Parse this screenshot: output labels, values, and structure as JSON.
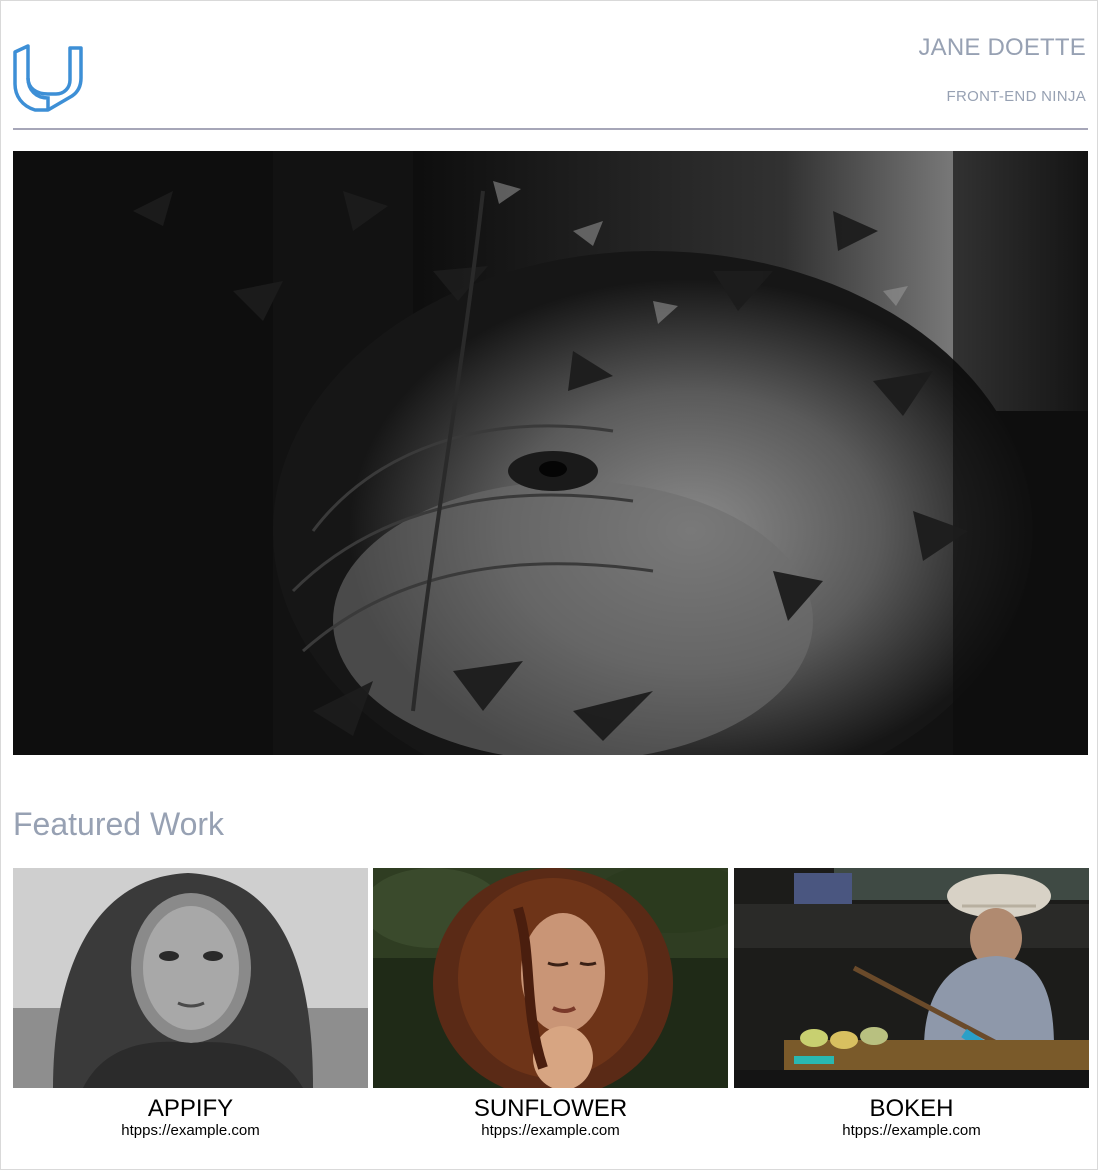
{
  "header": {
    "logo_icon": "udacity-u-logo-icon",
    "name": "JANE DOETTE",
    "role": "FRONT-END NINJA",
    "accent_color": "#3d8fd6",
    "text_color": "#97a1b3"
  },
  "hero": {
    "image": "elephant-in-foliage-photo"
  },
  "featured": {
    "heading": "Featured Work",
    "items": [
      {
        "title": "APPIFY",
        "link": "htpps://example.com",
        "image": "hooded-person-portrait-photo"
      },
      {
        "title": "SUNFLOWER",
        "link": "htpps://example.com",
        "image": "curly-hair-woman-photo"
      },
      {
        "title": "BOKEH",
        "link": "htpps://example.com",
        "image": "boat-vendor-photo"
      }
    ]
  }
}
